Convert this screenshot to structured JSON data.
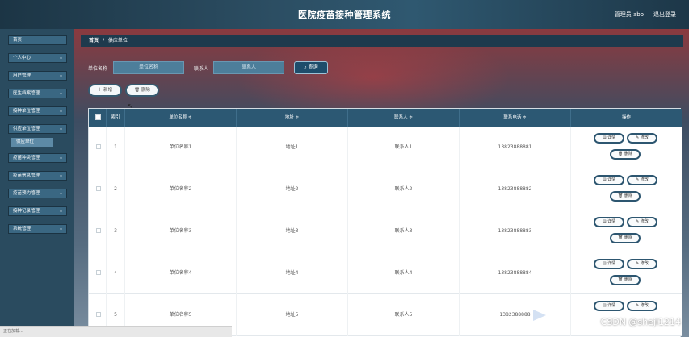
{
  "header": {
    "title": "医院疫苗接种管理系统",
    "admin": "管理员 abo",
    "logout": "退出登录"
  },
  "sidebar": {
    "items": [
      {
        "label": "首页",
        "chevron": false
      },
      {
        "label": "个人中心",
        "chevron": true
      },
      {
        "label": "用户管理",
        "chevron": true
      },
      {
        "label": "医生档案管理",
        "chevron": true
      },
      {
        "label": "接种单位管理",
        "chevron": true
      },
      {
        "label": "供应单位管理",
        "chevron": true
      },
      {
        "label": "疫苗种类管理",
        "chevron": true
      },
      {
        "label": "疫苗信息管理",
        "chevron": true
      },
      {
        "label": "疫苗预约管理",
        "chevron": true
      },
      {
        "label": "接种记录管理",
        "chevron": true
      },
      {
        "label": "系统管理",
        "chevron": true
      }
    ],
    "sub_item": "供应单位",
    "chevron_glyph": "⌄"
  },
  "breadcrumb": {
    "home": "首页",
    "sep": "/",
    "current": "供应单位"
  },
  "search": {
    "unit_label": "单位名称",
    "unit_placeholder": "单位名称",
    "contact_label": "联系人",
    "contact_placeholder": "联系人",
    "button": "查询",
    "search_icon": "search-icon"
  },
  "actions": {
    "add": "新增",
    "delete": "删除"
  },
  "table": {
    "columns": [
      "索引",
      "单位名称 ≑",
      "地址 ≑",
      "联系人 ≑",
      "联系电话 ≑",
      "操作"
    ],
    "rows": [
      {
        "index": "1",
        "name": "单位名称1",
        "address": "地址1",
        "contact": "联系人1",
        "phone": "13823888881"
      },
      {
        "index": "2",
        "name": "单位名称2",
        "address": "地址2",
        "contact": "联系人2",
        "phone": "13823888882"
      },
      {
        "index": "3",
        "name": "单位名称3",
        "address": "地址3",
        "contact": "联系人3",
        "phone": "13823888883"
      },
      {
        "index": "4",
        "name": "单位名称4",
        "address": "地址4",
        "contact": "联系人4",
        "phone": "13823888884"
      },
      {
        "index": "5",
        "name": "单位名称5",
        "address": "地址5",
        "contact": "联系人5",
        "phone": "1382388888"
      }
    ],
    "ops": {
      "detail": "详情",
      "edit": "修改",
      "remove": "删除"
    }
  },
  "statusbar": {
    "text": "正在加载..."
  },
  "watermark": {
    "text": "CSDN @sheji1214"
  },
  "colors": {
    "header": "#2c4e63",
    "sidebar": "#2a4b5f",
    "accent": "#2c5873"
  }
}
